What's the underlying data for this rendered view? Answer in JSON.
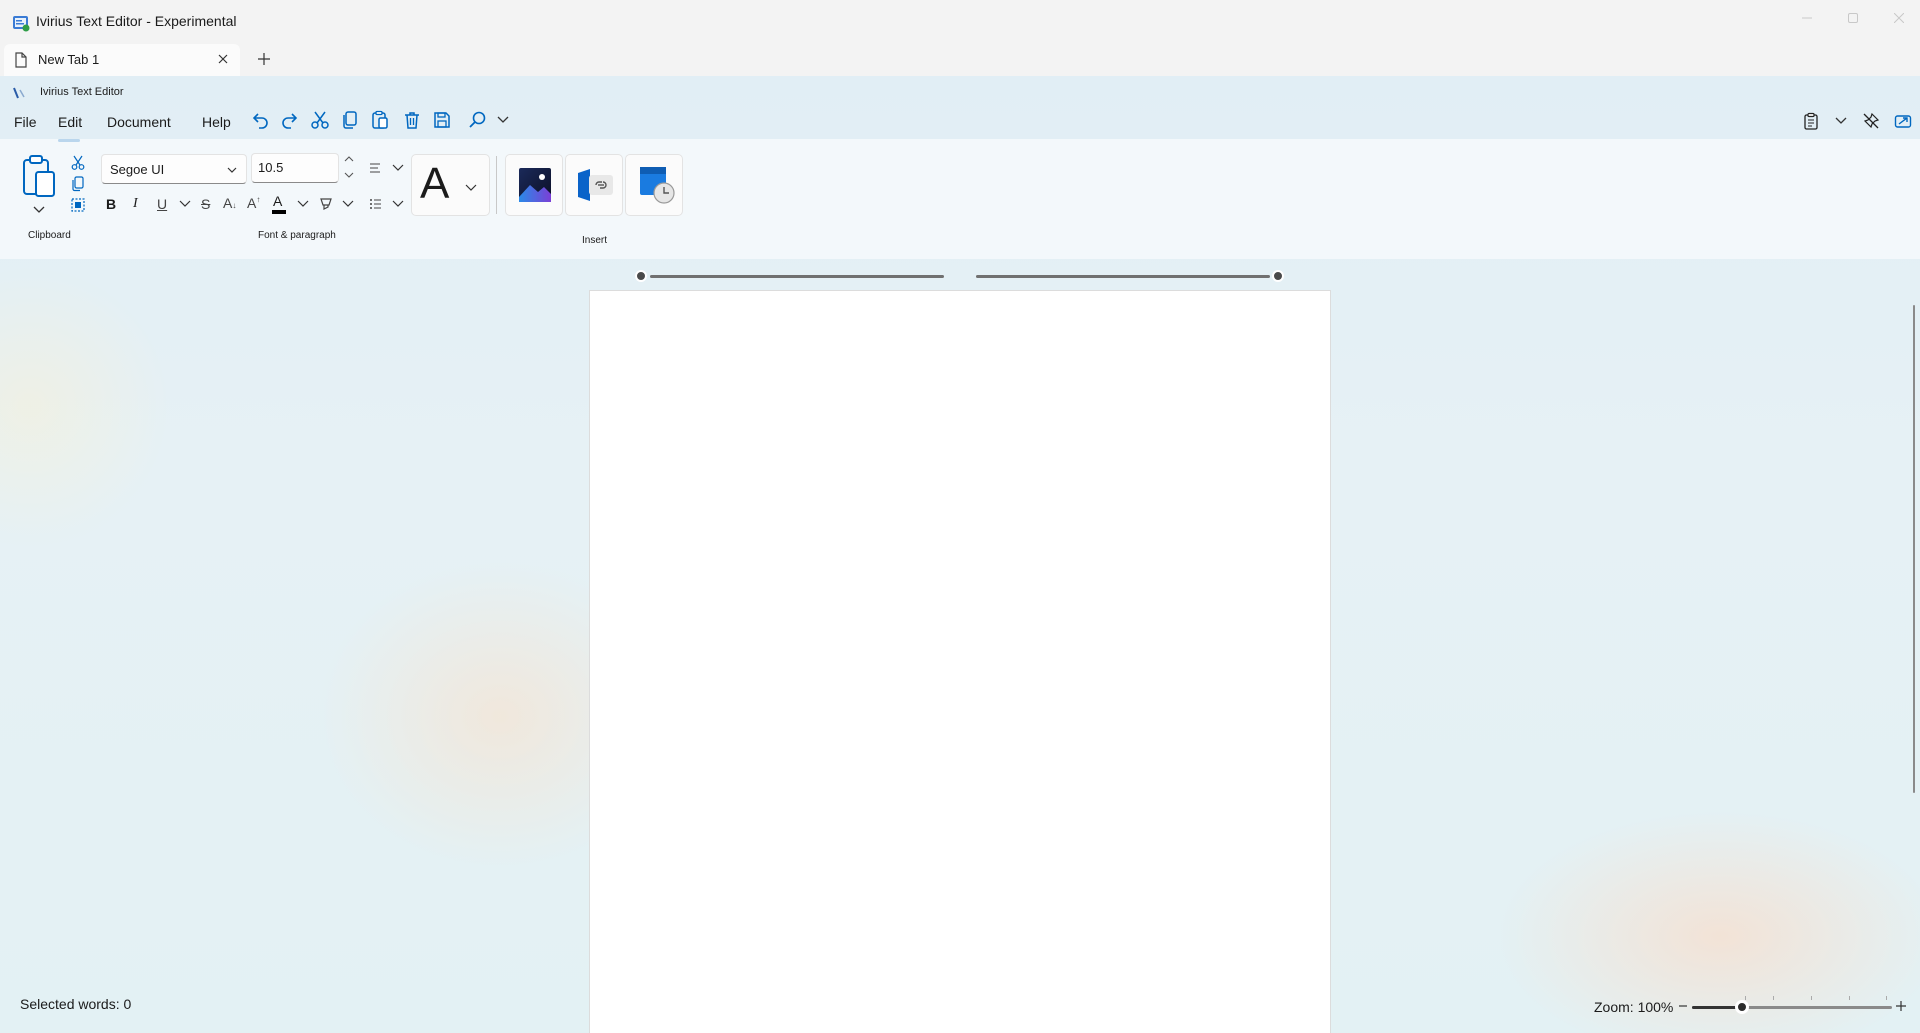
{
  "window": {
    "title": "Ivirius Text Editor - Experimental",
    "controls": [
      "minimize-icon",
      "maximize-icon",
      "close-icon"
    ]
  },
  "tabs": [
    {
      "label": "New Tab 1",
      "icon": "document-icon",
      "active": true
    }
  ],
  "app": {
    "brand_title": "Ivirius Text Editor"
  },
  "menu": {
    "items": [
      "File",
      "Edit",
      "Document",
      "Help"
    ],
    "active": "Edit"
  },
  "toolbar": {
    "quick_icons": [
      "undo-icon",
      "redo-icon",
      "cut-icon",
      "copy-icon",
      "paste-icon",
      "delete-icon",
      "save-icon",
      "find-icon",
      "chevron-down-icon"
    ],
    "right_icons": [
      "clipboard-icon",
      "chevron-down-icon",
      "pin-off-icon",
      "compact-mode-icon"
    ]
  },
  "ribbon": {
    "clipboard_label": "Clipboard",
    "font_paragraph_label": "Font & paragraph",
    "insert_label": "Insert",
    "font_family": "Segoe UI",
    "font_size": "10.5",
    "format_buttons": [
      "B",
      "I",
      "U",
      "S"
    ],
    "subscript_glyph": "A",
    "superscript_glyph": "A",
    "font_color_glyph": "A",
    "style_glyph": "A",
    "accent_color": "#0067c0"
  },
  "status": {
    "selected_words": "Selected words: 0",
    "zoom": "Zoom: 100%",
    "zoom_level": 0.25
  }
}
